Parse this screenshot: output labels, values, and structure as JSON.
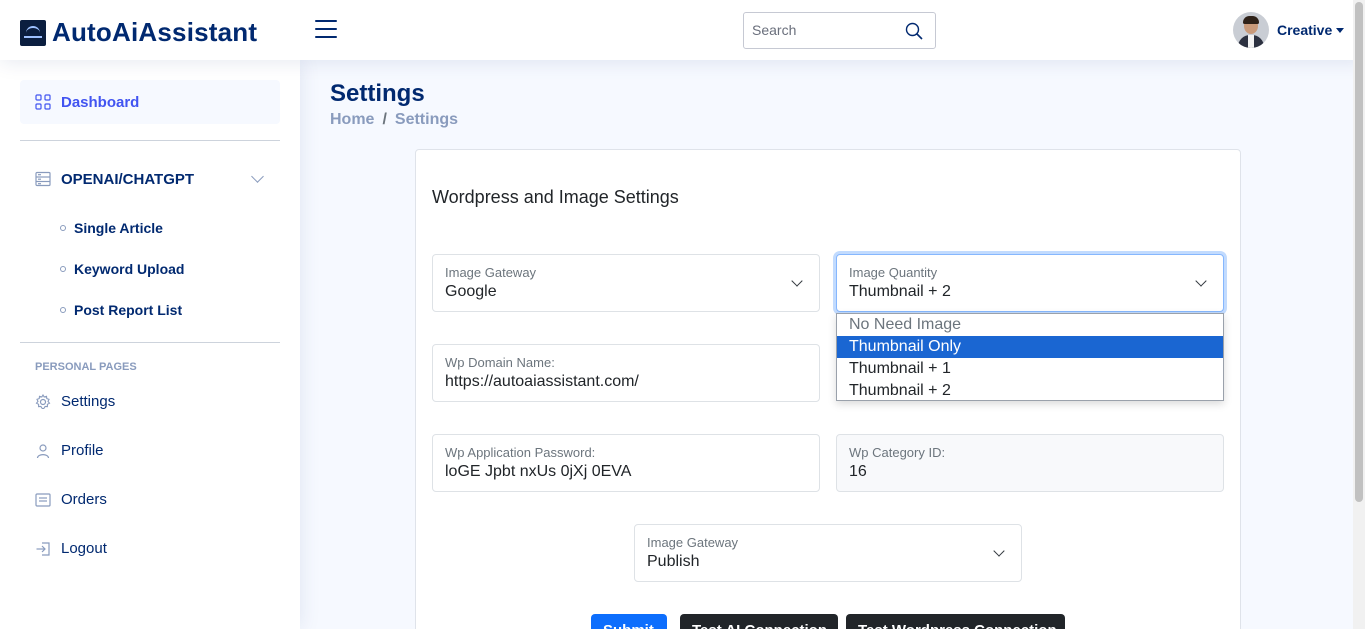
{
  "header": {
    "app_name": "AutoAiAssistant",
    "search_placeholder": "Search",
    "user_name": "Creative"
  },
  "sidebar": {
    "dashboard": "Dashboard",
    "openai_section": "OPENAI/CHATGPT",
    "openai_items": [
      "Single Article",
      "Keyword Upload",
      "Post Report List"
    ],
    "personal_heading": "PERSONAL PAGES",
    "personal_items": [
      "Settings",
      "Profile",
      "Orders",
      "Logout"
    ]
  },
  "page": {
    "title": "Settings",
    "breadcrumb": [
      "Home",
      "Settings"
    ]
  },
  "card": {
    "title": "Wordpress and Image Settings",
    "fields": {
      "image_gateway": {
        "label": "Image Gateway",
        "value": "Google"
      },
      "image_quantity": {
        "label": "Image Quantity",
        "value": "Thumbnail + 2"
      },
      "wp_domain": {
        "label": "Wp Domain Name:",
        "value": "https://autoaiassistant.com/"
      },
      "wp_password": {
        "label": "Wp Application Password:",
        "value": "loGE Jpbt nxUs 0jXj 0EVA"
      },
      "wp_category": {
        "label": "Wp Category ID:",
        "value": "16"
      },
      "publish_gateway": {
        "label": "Image Gateway",
        "value": "Publish"
      }
    },
    "quantity_options": [
      "No Need Image",
      "Thumbnail Only",
      "Thumbnail + 1",
      "Thumbnail + 2"
    ],
    "quantity_highlighted": "Thumbnail Only",
    "buttons": [
      "Submit",
      "Test AI Connection",
      "Test Wordpress Connection"
    ]
  },
  "colors": {
    "accent": "#4154f1",
    "navy": "#012970",
    "primary_button": "#0d6efd",
    "dark_button": "#212529",
    "option_highlight": "#1a66d2"
  }
}
